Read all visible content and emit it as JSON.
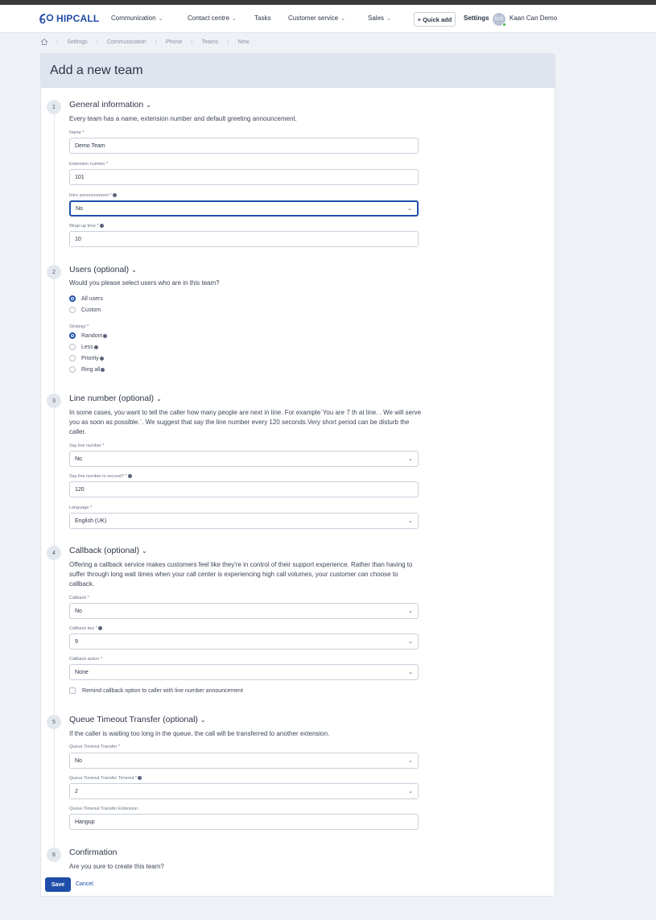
{
  "nav": {
    "brand": "HIPCALL",
    "items": [
      {
        "label": "Communication",
        "dropdown": true
      },
      {
        "label": "Contact centre",
        "dropdown": true
      },
      {
        "label": "Tasks",
        "dropdown": false
      },
      {
        "label": "Customer service",
        "dropdown": true
      },
      {
        "label": "Sales",
        "dropdown": true
      }
    ],
    "quick_add": "+ Quick add",
    "settings": "Settings",
    "avatar_initials": "KCD",
    "user_name": "Kaan Can Demo"
  },
  "breadcrumb": [
    "Settings",
    "Communication",
    "Phone",
    "Teams",
    "New"
  ],
  "page": {
    "title": "Add a new team"
  },
  "sections": {
    "general": {
      "number": "1",
      "title": "General information",
      "description": "Every team has a name, extension number and default greeting announcement.",
      "name_label": "Name *",
      "name_value": "Demo Team",
      "extension_label": "Extension number *",
      "extension_value": "101",
      "intro_label": "Intro announcement *",
      "intro_value": "No",
      "wrapup_label": "Wrap-up time *",
      "wrapup_value": "10"
    },
    "users": {
      "number": "2",
      "title": "Users (optional)",
      "description": "Would you please select users who are in this team?",
      "options": [
        "All users",
        "Custom"
      ],
      "selected": "All users",
      "strategy_label": "Strategy *",
      "strategies": [
        "Random",
        "Less",
        "Priority",
        "Ring all"
      ],
      "strategy_selected": "Random"
    },
    "line_number": {
      "number": "3",
      "title": "Line number (optional)",
      "description": "In some cases, you want to tell the caller how many people are next in line. For example`You are 7 th at line. . We will serve you as soon as possible.`. We suggest that say the line number every 120 seconds.Very short period can be disturb the caller.",
      "say_label": "Say line number *",
      "say_value": "No",
      "seconds_label": "Say line number in second? *",
      "seconds_value": "120",
      "language_label": "Language *",
      "language_value": "English (UK)"
    },
    "callback": {
      "number": "4",
      "title": "Callback (optional)",
      "description": "Offering a callback service makes customers feel like they're in control of their support experience. Rather than having to suffer through long wait times when your call center is experiencing high call volumes, your customer can choose to callback.",
      "callback_label": "Callback *",
      "callback_value": "No",
      "key_label": "Callback key *",
      "key_value": "9",
      "action_label": "Callback action *",
      "action_value": "None",
      "remind_label": "Remind callback option to caller with line number announcement"
    },
    "timeout": {
      "number": "5",
      "title": "Queue Timeout Transfer (optional)",
      "description": "If the caller is waiting too long in the queue, the call will be transferred to another extension.",
      "transfer_label": "Queue Timeout Transfer *",
      "transfer_value": "No",
      "timeout_label": "Queue Timeout Transfer Timeout *",
      "timeout_value": "2",
      "extension_label": "Queue Timeout Transfer Extension",
      "extension_value": "Hangup"
    },
    "confirmation": {
      "number": "6",
      "title": "Confirmation",
      "description": "Are you sure to create this team?"
    }
  },
  "actions": {
    "save": "Save",
    "cancel": "Cancel"
  }
}
